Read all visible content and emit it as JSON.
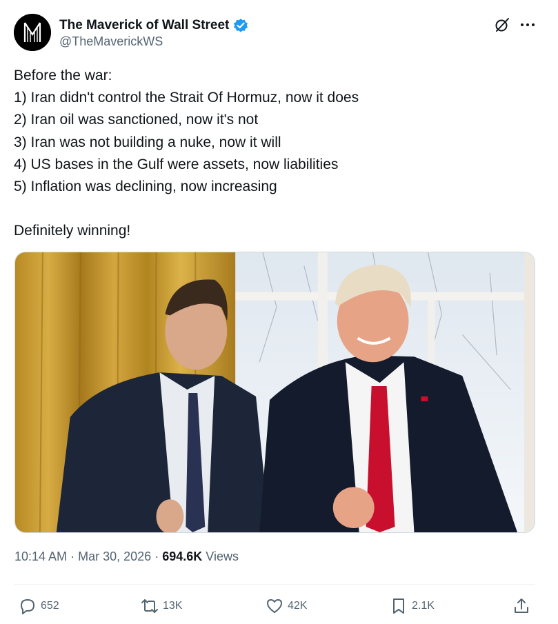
{
  "author": {
    "display_name": "The Maverick of Wall Street",
    "handle": "@TheMaverickWS",
    "verified": true,
    "avatar_icon": "maverick-logo",
    "verified_color": "#1d9bf0"
  },
  "header_icons": [
    "grok-icon",
    "more-icon"
  ],
  "tweet": {
    "lines": [
      "Before the war:",
      "1) Iran didn't control the Strait Of Hormuz, now it does",
      "2) Iran oil was sanctioned, now it's not",
      "3) Iran was not building a nuke, now it will",
      "4) US bases in the Gulf were assets, now liabilities",
      "5) Inflation was declining, now increasing",
      "",
      "Definitely winning!"
    ]
  },
  "media": {
    "type": "photo"
  },
  "meta": {
    "time": "10:14 AM",
    "separator": "·",
    "date": "Mar 30, 2026",
    "views_count": "694.6K",
    "views_label": "Views"
  },
  "actions": {
    "replies": "652",
    "reposts": "13K",
    "likes": "42K",
    "bookmarks": "2.1K"
  },
  "colors": {
    "text": "#0f1419",
    "secondary": "#536471",
    "accent": "#1d9bf0"
  }
}
